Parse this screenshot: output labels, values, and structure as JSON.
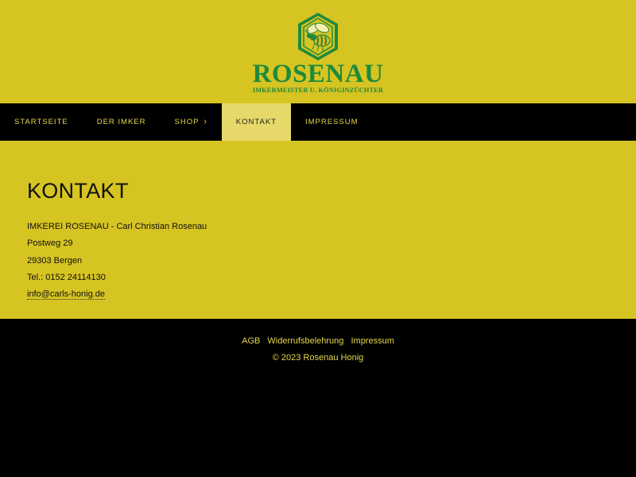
{
  "colors": {
    "primary_yellow": "#d6c422",
    "active_nav_bg": "#e6d96a",
    "logo_green": "#1f8a3a",
    "footer_text": "#e6d84a",
    "nav_bg": "#000000"
  },
  "header": {
    "logo_icon": "bee-hexagon-icon",
    "logo_title": "ROSENAU",
    "logo_subtitle": "IMKERMEISTER U. KÖNIGINZÜCHTER"
  },
  "nav": {
    "items": [
      {
        "label": "STARTSEITE"
      },
      {
        "label": "DER IMKER"
      },
      {
        "label": "SHOP"
      },
      {
        "label": "KONTAKT"
      },
      {
        "label": "IMPRESSUM"
      }
    ],
    "shop_chevron_icon": "chevron-right-icon"
  },
  "main": {
    "title": "KONTAKT",
    "lines": [
      "IMKEREI ROSENAU - Carl Christian Rosenau",
      "Postweg 29",
      "29303 Bergen",
      "Tel.: 0152 24114130"
    ],
    "email": "info@carls-honig.de"
  },
  "footer": {
    "links": [
      "AGB",
      "Widerrufsbelehrung",
      "Impressum"
    ],
    "copyright": "© 2023 Rosenau Honig"
  }
}
